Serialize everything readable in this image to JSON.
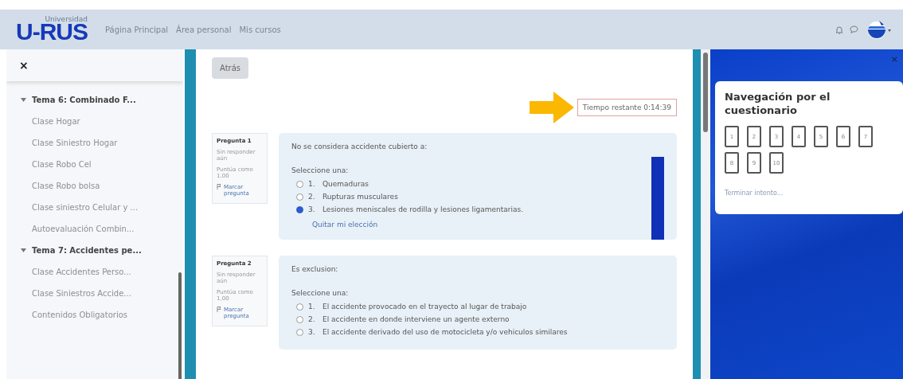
{
  "header": {
    "logo_small": "Universidad",
    "logo": "U-RUS",
    "nav": [
      "Página Principal",
      "Área personal",
      "Mis cursos"
    ]
  },
  "sidebar": {
    "close": "×",
    "sections": [
      {
        "title": "Tema 6: Combinado F...",
        "expanded": true,
        "children": [
          "Clase Hogar",
          "Clase Siniestro Hogar",
          "Clase Robo Cel",
          "Clase Robo bolsa",
          "Clase siniestro Celular y ...",
          "Autoevaluación Combin..."
        ]
      },
      {
        "title": "Tema 7: Accidentes pe...",
        "expanded": true,
        "children": [
          "Clase Accidentes Perso...",
          "Clase Siniestros Accide...",
          "Contenidos Obligatorios"
        ]
      }
    ]
  },
  "main": {
    "back": "Atrás",
    "timer": "Tiempo restante 0:14:39",
    "questions": [
      {
        "number": "Pregunta 1",
        "status": "Sin responder aún",
        "points": "Puntúa como 1,00",
        "flag": "Marcar pregunta",
        "text": "No se considera accidente cubierto a:",
        "prompt": "Seleccione una:",
        "options": [
          {
            "letter": "1.",
            "text": "Quemaduras",
            "selected": false
          },
          {
            "letter": "2.",
            "text": "Rupturas musculares",
            "selected": false
          },
          {
            "letter": "3.",
            "text": "Lesiones meniscales de rodilla y lesiones ligamentarias.",
            "selected": true
          }
        ],
        "clear": "Quitar mi elección"
      },
      {
        "number": "Pregunta 2",
        "status": "Sin responder aún",
        "points": "Puntúa como 1,00",
        "flag": "Marcar pregunta",
        "text": "Es exclusion:",
        "prompt": "Seleccione una:",
        "options": [
          {
            "letter": "1.",
            "text": "El accidente provocado en el trayecto al lugar de trabajo",
            "selected": false
          },
          {
            "letter": "2.",
            "text": "El accidente en donde interviene un agente externo",
            "selected": false
          },
          {
            "letter": "3.",
            "text": "El accidente derivado del uso de motocicleta y/o vehiculos similares",
            "selected": false
          }
        ]
      }
    ]
  },
  "nav_panel": {
    "close": "×",
    "title": "Navegación por el cuestionario",
    "buttons": [
      "1",
      "2",
      "3",
      "4",
      "5",
      "6",
      "7",
      "8",
      "9",
      "10"
    ],
    "finish": "Terminar intento..."
  }
}
